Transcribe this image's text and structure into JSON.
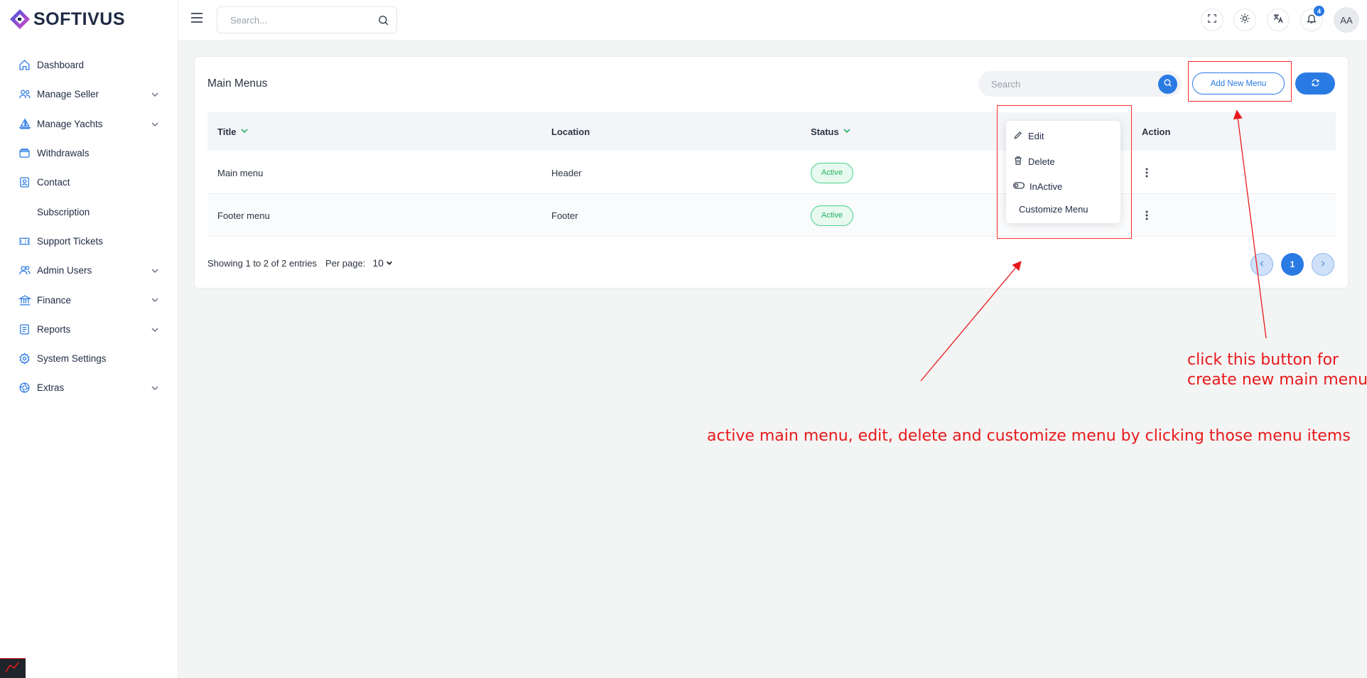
{
  "brand": {
    "name": "SOFTIVUS"
  },
  "sidebar": {
    "items": [
      {
        "label": "Dashboard",
        "icon": "home-icon",
        "expandable": false
      },
      {
        "label": "Manage Seller",
        "icon": "users-icon",
        "expandable": true
      },
      {
        "label": "Manage Yachts",
        "icon": "sailboat-icon",
        "expandable": true
      },
      {
        "label": "Withdrawals",
        "icon": "wallet-icon",
        "expandable": false
      },
      {
        "label": "Contact",
        "icon": "contact-book-icon",
        "expandable": false
      },
      {
        "label": "Subscription",
        "icon": "",
        "expandable": false
      },
      {
        "label": "Support Tickets",
        "icon": "ticket-icon",
        "expandable": false
      },
      {
        "label": "Admin Users",
        "icon": "admin-users-icon",
        "expandable": true
      },
      {
        "label": "Finance",
        "icon": "bank-icon",
        "expandable": true
      },
      {
        "label": "Reports",
        "icon": "report-icon",
        "expandable": true
      },
      {
        "label": "System Settings",
        "icon": "gear-icon",
        "expandable": false
      },
      {
        "label": "Extras",
        "icon": "aperture-icon",
        "expandable": true
      }
    ]
  },
  "topbar": {
    "search_placeholder": "Search...",
    "notification_count": "4",
    "avatar_initials": "AA"
  },
  "card": {
    "title": "Main Menus",
    "search_placeholder": "Search",
    "add_button_label": "Add New Menu"
  },
  "table": {
    "columns": [
      "Title",
      "Location",
      "Status",
      "Action"
    ],
    "rows": [
      {
        "title": "Main menu",
        "location": "Header",
        "status": "Active"
      },
      {
        "title": "Footer menu",
        "location": "Footer",
        "status": "Active"
      }
    ]
  },
  "action_menu": {
    "items": [
      "Edit",
      "Delete",
      "InActive",
      "Customize Menu"
    ]
  },
  "pagination": {
    "summary": "Showing 1 to 2 of 2 entries",
    "per_page_label": "Per page:",
    "per_page_value": "10",
    "current_page": "1"
  },
  "annotations": {
    "button_note_line1": "click this button for",
    "button_note_line2": "create new main menu",
    "menu_note": "active main menu, edit, delete and customize menu by clicking those menu items",
    "color": "#e8191b"
  },
  "colors": {
    "accent": "#2a7ae4",
    "active_badge": "#22b366"
  }
}
